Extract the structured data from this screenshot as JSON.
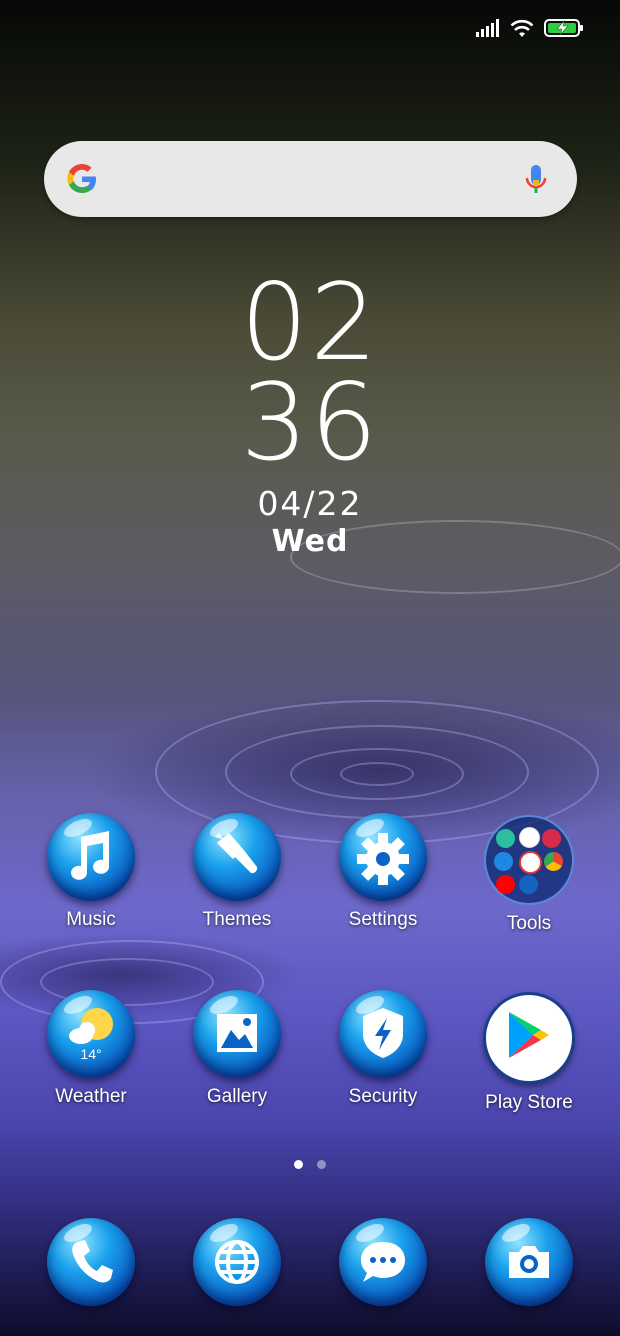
{
  "status_bar": {
    "signal_icon": "signal-bars-icon",
    "wifi_icon": "wifi-icon",
    "battery_icon": "battery-charging-icon"
  },
  "search": {
    "placeholder": "",
    "google_icon": "google-g-icon",
    "mic_icon": "mic-icon"
  },
  "clock": {
    "hours": "02",
    "minutes": "36",
    "date": "04/22",
    "weekday": "Wed"
  },
  "apps_row1": [
    {
      "label": "Music",
      "icon": "music-note-icon"
    },
    {
      "label": "Themes",
      "icon": "paintbrush-icon"
    },
    {
      "label": "Settings",
      "icon": "gear-icon"
    },
    {
      "label": "Tools",
      "icon": "folder-icon"
    }
  ],
  "apps_row2": [
    {
      "label": "Weather",
      "icon": "weather-icon",
      "temp": "14°"
    },
    {
      "label": "Gallery",
      "icon": "gallery-icon"
    },
    {
      "label": "Security",
      "icon": "shield-bolt-icon"
    },
    {
      "label": "Play Store",
      "icon": "play-store-icon"
    }
  ],
  "page_indicator": {
    "pages": 2,
    "current": 1
  },
  "dock": [
    {
      "icon": "phone-icon"
    },
    {
      "icon": "browser-globe-icon"
    },
    {
      "icon": "messages-icon"
    },
    {
      "icon": "camera-icon"
    }
  ]
}
